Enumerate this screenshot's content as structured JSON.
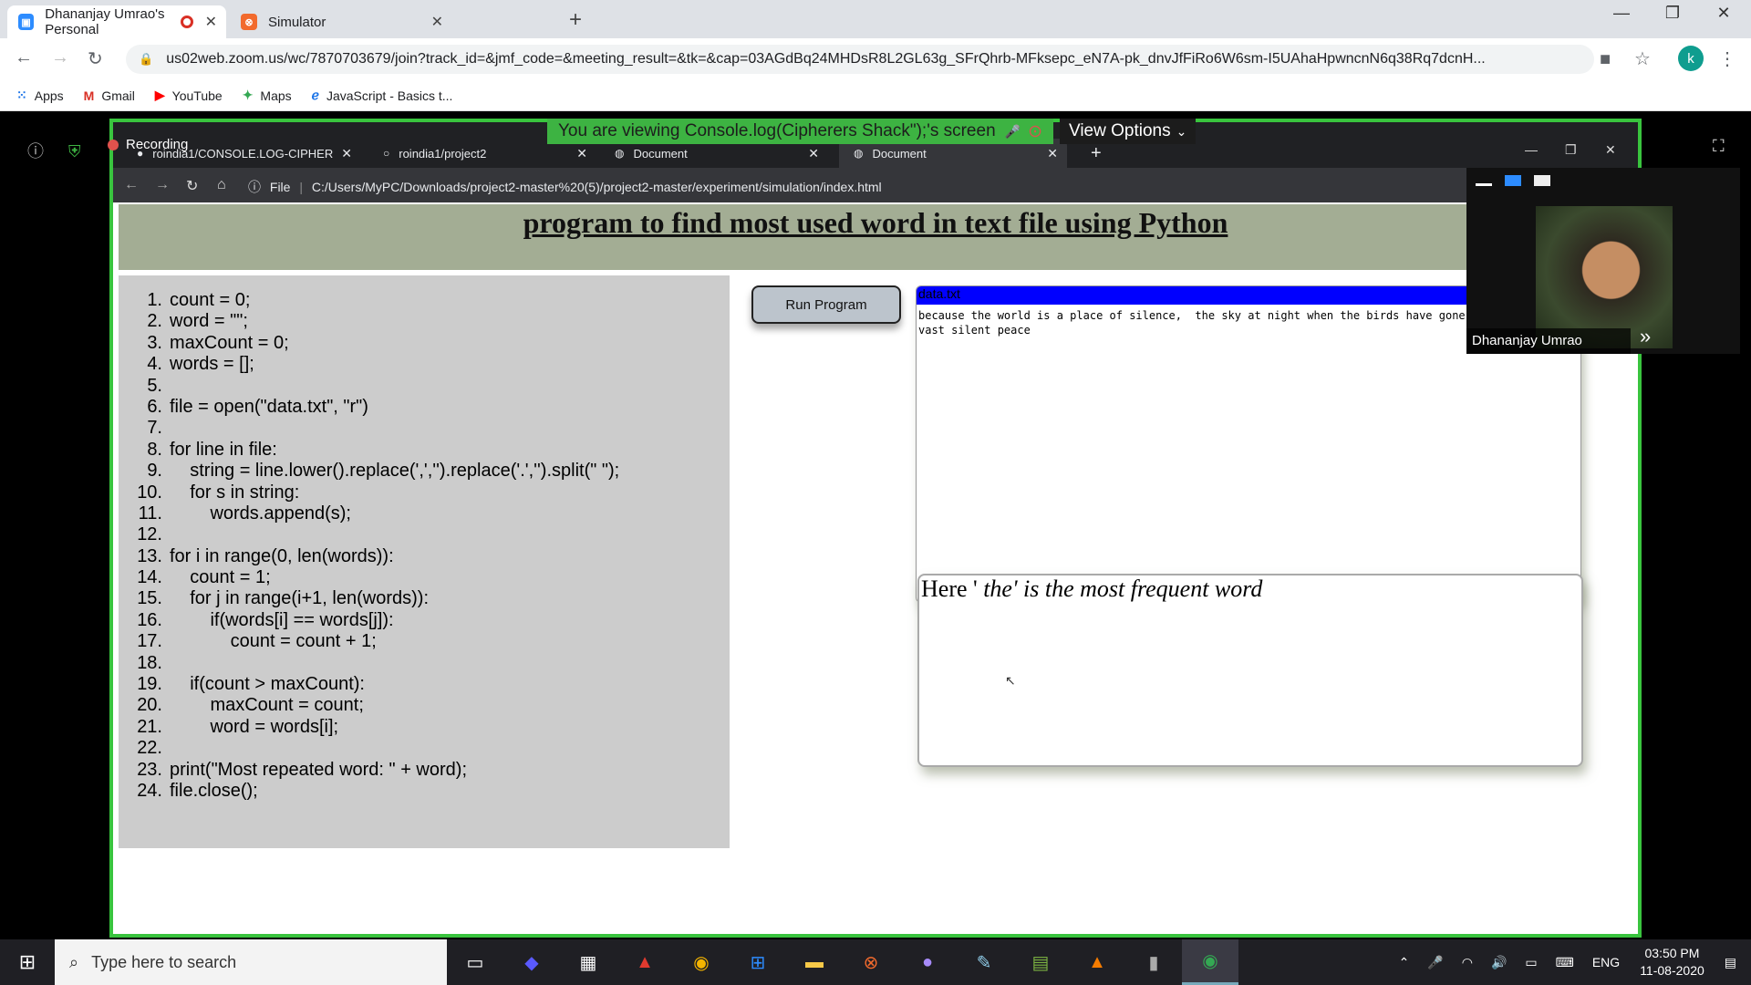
{
  "browser": {
    "tabs": [
      {
        "title": "Dhananjay Umrao's Personal",
        "active": true
      },
      {
        "title": "Simulator",
        "active": false
      }
    ],
    "url": "us02web.zoom.us/wc/7870703679/join?track_id=&jmf_code=&meeting_result=&tk=&cap=03AGdBq24MHDsR8L2GL63g_SFrQhrb-MFksepc_eN7A-pk_dnvJfFiRo6W6sm-I5UAhaHpwncnN6q38Rq7dcnH...",
    "avatar_letter": "k",
    "bookmarks": [
      {
        "label": "Apps",
        "icon": "apps-grid-icon"
      },
      {
        "label": "Gmail",
        "icon": "gmail-icon"
      },
      {
        "label": "YouTube",
        "icon": "youtube-icon"
      },
      {
        "label": "Maps",
        "icon": "maps-icon"
      },
      {
        "label": "JavaScript - Basics t...",
        "icon": "javascript-icon"
      }
    ]
  },
  "zoom": {
    "recording_label": "Recording",
    "viewing_label": "You are viewing Console.log(Cipherers Shack\");'s screen",
    "view_options_label": "View Options",
    "participant_name": "Dhananjay Umrao"
  },
  "shared": {
    "tabs": [
      {
        "title": "roindia1/CONSOLE.LOG-CIPHER"
      },
      {
        "title": "roindia1/project2"
      },
      {
        "title": "Document"
      },
      {
        "title": "Document"
      }
    ],
    "file_label": "File",
    "url": "C:/Users/MyPC/Downloads/project2-master%20(5)/project2-master/experiment/simulation/index.html",
    "page_title": "program to find most used word in text file using Python",
    "code_lines": [
      "count = 0;",
      "word = \"\";",
      "maxCount = 0;",
      "words = [];",
      "",
      "file = open(\"data.txt\", \"r\")",
      "",
      "for line in file:",
      "    string = line.lower().replace(',','').replace('.','').split(\" \");",
      "    for s in string:",
      "        words.append(s);",
      "",
      "for i in range(0, len(words)):",
      "    count = 1;",
      "    for j in range(i+1, len(words)):",
      "        if(words[i] == words[j]):",
      "            count = count + 1;",
      "",
      "    if(count > maxCount):",
      "        maxCount = count;",
      "        word = words[i];",
      "",
      "print(\"Most repeated word: \" + word);",
      "file.close();"
    ],
    "run_button": "Run Program",
    "file_title": "data.txt",
    "file_content": "because the world is a place of silence,  the sky at night when the birds have gone\nvast silent peace",
    "output_prefix": "Here '",
    "output_rest": " the' is the most frequent word"
  },
  "taskbar": {
    "search_placeholder": "Type here to search",
    "language": "ENG",
    "time": "03:50 PM",
    "date": "11-08-2020"
  }
}
